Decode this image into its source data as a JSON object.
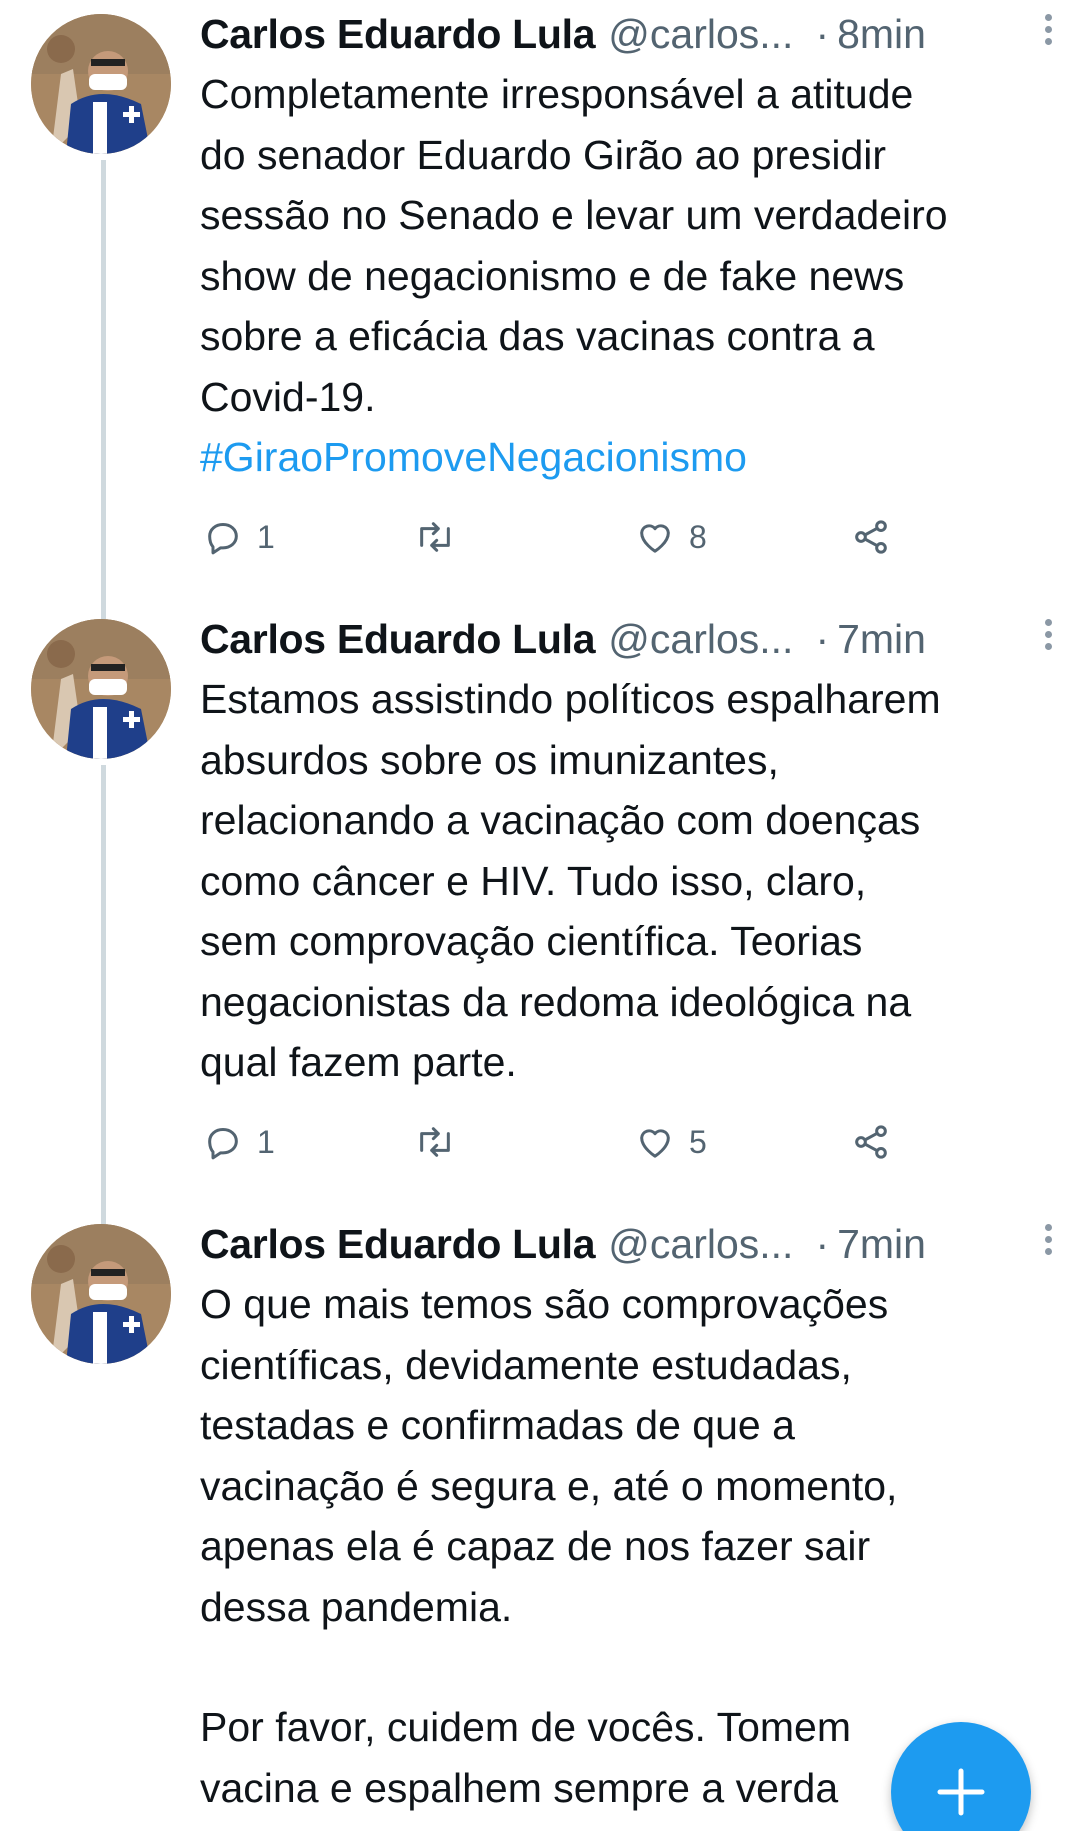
{
  "colors": {
    "accent": "#1d9bf0",
    "text": "#0f1419",
    "secondary": "#536471",
    "thread_line": "#cfd9de"
  },
  "tweets": [
    {
      "author": {
        "name": "Carlos Eduardo Lula",
        "handle": "@carlos...",
        "avatar_icon": "user-avatar-photo"
      },
      "separator": "·",
      "time": "8min",
      "text_lines": [
        "Completamente irresponsável a atitude",
        "do senador Eduardo Girão ao presidir",
        "sessão no Senado e levar um verdadeiro",
        "show de negacionismo e de fake news",
        "sobre a eficácia das vacinas contra a",
        "Covid-19."
      ],
      "hashtag": "#GiraoPromoveNegacionismo",
      "actions": {
        "reply_count": "1",
        "retweet_count": "",
        "like_count": "8"
      }
    },
    {
      "author": {
        "name": "Carlos Eduardo Lula",
        "handle": "@carlos...",
        "avatar_icon": "user-avatar-photo"
      },
      "separator": "·",
      "time": "7min",
      "text_lines": [
        "Estamos assistindo políticos espalharem",
        "absurdos sobre os imunizantes,",
        "relacionando a vacinação com doenças",
        "como câncer e HIV. Tudo isso, claro,",
        "sem comprovação científica. Teorias",
        "negacionistas da redoma ideológica na",
        "qual fazem parte."
      ],
      "actions": {
        "reply_count": "1",
        "retweet_count": "",
        "like_count": "5"
      }
    },
    {
      "author": {
        "name": "Carlos Eduardo Lula",
        "handle": "@carlos...",
        "avatar_icon": "user-avatar-photo"
      },
      "separator": "·",
      "time": "7min",
      "text_lines": [
        "O que mais temos são comprovações",
        "científicas, devidamente estudadas,",
        "testadas e confirmadas de que a",
        "vacinação é segura e, até o momento,",
        "apenas ela é capaz de nos fazer sair",
        "dessa pandemia."
      ],
      "text_lines_2": [
        "Por favor, cuidem de vocês. Tomem",
        "vacina e espalhem sempre a verda"
      ]
    }
  ],
  "fab": {
    "icon": "plus-icon",
    "label": "+"
  }
}
